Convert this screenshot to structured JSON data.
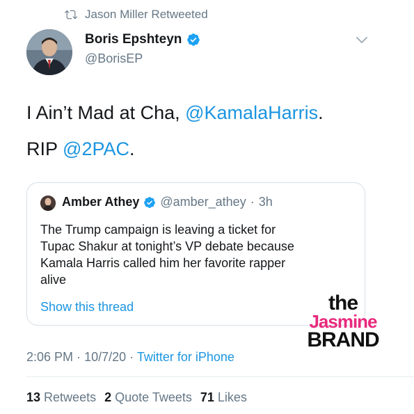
{
  "retweet": {
    "text": "Jason Miller Retweeted"
  },
  "author": {
    "name": "Boris Epshteyn",
    "handle": "@BorisEP"
  },
  "tweet": {
    "line1_text": "I Ain’t Mad at Cha, ",
    "line1_mention": "@KamalaHarris",
    "line1_end": ".",
    "line2_text": "RIP ",
    "line2_mention": "@2PAC",
    "line2_end": "."
  },
  "quote": {
    "name": "Amber Athey",
    "handle": "@amber_athey",
    "separator": "·",
    "time": "3h",
    "lines": [
      "The Trump campaign is leaving a ticket for",
      "Tupac Shakur at tonight’s VP debate because",
      "Kamala Harris called him her favorite rapper",
      "alive"
    ],
    "show_thread": "Show this thread"
  },
  "meta": {
    "time": "2:06 PM",
    "sep1": "·",
    "date": "10/7/20",
    "sep2": "·",
    "source": "Twitter for iPhone"
  },
  "stats": {
    "retweets_count": "13",
    "retweets_label": "Retweets",
    "quotes_count": "2",
    "quotes_label": "Quote Tweets",
    "likes_count": "71",
    "likes_label": "Likes"
  },
  "watermark": {
    "the": "the",
    "jasmine": "Jasmine",
    "brand": "BRAND"
  },
  "colors": {
    "link": "#1b95e0",
    "muted": "#657786",
    "verified": "#1da1f2",
    "watermark_pink": "#e8297d"
  },
  "icons": {
    "retweet": "retweet-icon",
    "verified": "verified-badge-icon",
    "caret": "chevron-down-icon"
  }
}
